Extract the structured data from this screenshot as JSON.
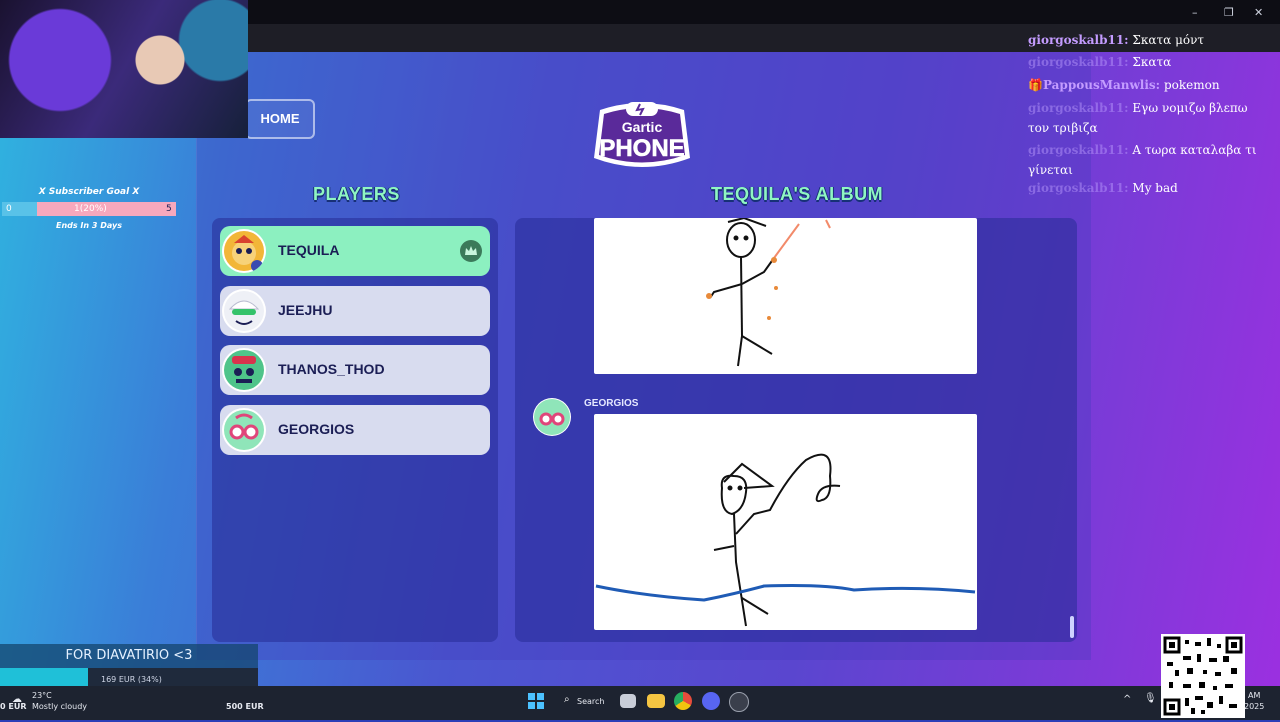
{
  "window": {
    "controls": [
      "–",
      "❐",
      "✕"
    ]
  },
  "game": {
    "home_label": "HOME",
    "logo": {
      "top": "Gartic",
      "bottom": "PHONE"
    },
    "players_title": "PLAYERS",
    "album_title": "TEQUILA'S ALBUM",
    "players": [
      {
        "name": "TEQUILA",
        "active": true,
        "host": true
      },
      {
        "name": "JEEJHU",
        "active": false
      },
      {
        "name": "THANOS_THOD",
        "active": false
      },
      {
        "name": "GEORGIOS",
        "active": false
      }
    ],
    "album_author": "GEORGIOS"
  },
  "stream_overlay": {
    "goal": {
      "title": "X Subscriber Goal X",
      "start": "0",
      "progress": "1(20%)",
      "target": "5",
      "fraction": 0.2,
      "ends": "Ends In 3 Days"
    },
    "donation": {
      "label": "FOR DIAVATIRIO <3",
      "amount": "169 EUR (34%)",
      "fraction": 0.34
    }
  },
  "chat": [
    {
      "user": "giorgoskalb11:",
      "text": "Σκατα μόντ",
      "faded": false
    },
    {
      "user": "giorgoskalb11:",
      "text": "Σκατα",
      "faded": true
    },
    {
      "user": "PappousManwlis:",
      "text": "pokemon",
      "faded": false,
      "badge": "🎁"
    },
    {
      "user": "giorgoskalb11:",
      "text": "Εγω νομιζω βλεπω τον τριβιζα",
      "faded": true
    },
    {
      "user": "giorgoskalb11:",
      "text": "Α τωρα καταλαβα τι γίνεται",
      "faded": true
    },
    {
      "user": "giorgoskalb11:",
      "text": "My bad",
      "faded": true
    }
  ],
  "taskbar": {
    "left_amount": "0 EUR",
    "weather_temp": "23°C",
    "weather_desc": "Mostly cloudy",
    "right_amount": "500 EUR",
    "search_label": "Search",
    "clock_ampm": "AM",
    "clock_year": "2025"
  },
  "colors": {
    "accent": "#8ff6c2",
    "active_player": "#8cf0c0",
    "player": "#d8dcef"
  }
}
